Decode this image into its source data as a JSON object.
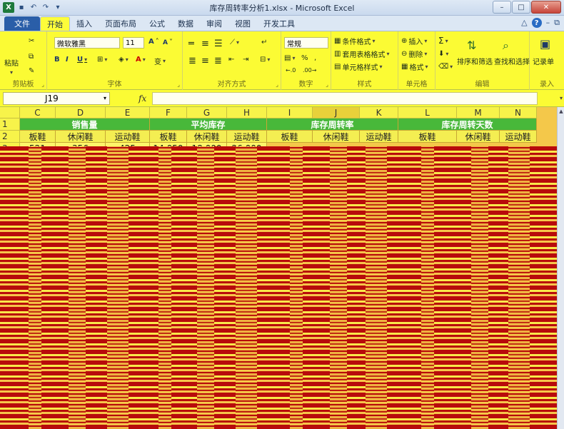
{
  "window": {
    "title": "库存周转率分析1.xlsx - Microsoft Excel"
  },
  "tabs": [
    "文件",
    "开始",
    "插入",
    "页面布局",
    "公式",
    "数据",
    "审阅",
    "视图",
    "开发工具"
  ],
  "ribbon": {
    "clipboard": {
      "paste": "粘贴",
      "label": "剪贴板"
    },
    "font": {
      "name": "微软雅黑",
      "size": "11",
      "label": "字体",
      "bold": "B",
      "italic": "I",
      "underline": "U",
      "grow": "A",
      "shrink": "A",
      "fill_icon": "fill-color-icon",
      "font_color_icon": "font-color-icon",
      "wen": "变"
    },
    "alignment": {
      "label": "对齐方式"
    },
    "number": {
      "format": "常规",
      "percent": "%",
      "comma": ",",
      "label": "数字"
    },
    "styles": {
      "conditional": "条件格式",
      "table": "套用表格格式",
      "cell": "单元格样式",
      "label": "样式"
    },
    "cells": {
      "insert": "插入",
      "delete": "删除",
      "format": "格式",
      "label": "单元格"
    },
    "editing": {
      "sigma": "Σ",
      "sort": "排序和筛选",
      "find": "查找和选择",
      "label": "编辑"
    },
    "record": {
      "button": "记录单",
      "label": "录入"
    }
  },
  "formula_bar": {
    "name_box": "J19",
    "fx": "fx",
    "content": ""
  },
  "columns": [
    "C",
    "D",
    "E",
    "F",
    "G",
    "H",
    "I",
    "J",
    "K",
    "L",
    "M",
    "N"
  ],
  "rows": [
    "1",
    "2",
    "3"
  ],
  "table": {
    "group_headers": [
      "销售量",
      "平均库存",
      "库存周转率",
      "库存周转天数"
    ],
    "sub_headers": [
      "板鞋",
      "休闲鞋",
      "运动鞋",
      "板鞋",
      "休闲鞋",
      "运动鞋",
      "板鞋",
      "休闲鞋",
      "运动鞋",
      "板鞋",
      "休闲鞋",
      "运动鞋"
    ],
    "row3": [
      "521",
      "356",
      "425",
      "14,050",
      "18,000",
      "26,000"
    ]
  },
  "colors": {
    "header_green": "#48b83a",
    "ribbon_yellow": "#fbfb34",
    "glitch_red": "#b80b0b"
  }
}
